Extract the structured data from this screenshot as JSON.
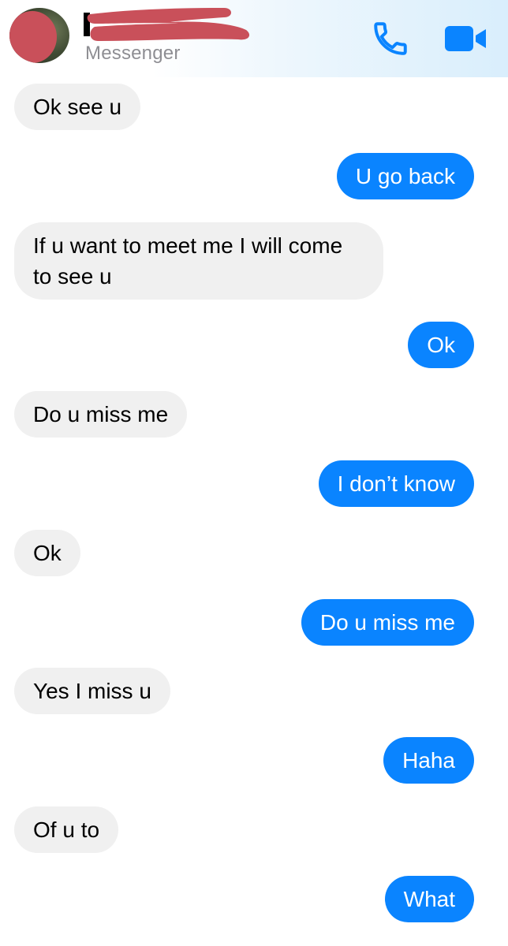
{
  "header": {
    "subtitle": "Messenger",
    "phone_icon": "phone-icon",
    "video_icon": "video-camera-icon",
    "accent_color": "#0a84ff"
  },
  "messages": [
    {
      "side": "in",
      "text": "Ok see u"
    },
    {
      "side": "out",
      "text": "U go back"
    },
    {
      "side": "in",
      "text": "If u want to meet me I will come to see u"
    },
    {
      "side": "out",
      "text": "Ok"
    },
    {
      "side": "in",
      "text": "Do u miss me"
    },
    {
      "side": "out",
      "text": "I don’t know"
    },
    {
      "side": "in",
      "text": "Ok"
    },
    {
      "side": "out",
      "text": "Do u miss me"
    },
    {
      "side": "in",
      "text": "Yes I miss u"
    },
    {
      "side": "out",
      "text": "Haha"
    },
    {
      "side": "in",
      "text": "Of u to"
    },
    {
      "side": "out",
      "text": "What"
    }
  ],
  "colors": {
    "incoming_bubble": "#f0f0f0",
    "outgoing_bubble": "#0a84ff",
    "redaction": "#c9505a"
  }
}
